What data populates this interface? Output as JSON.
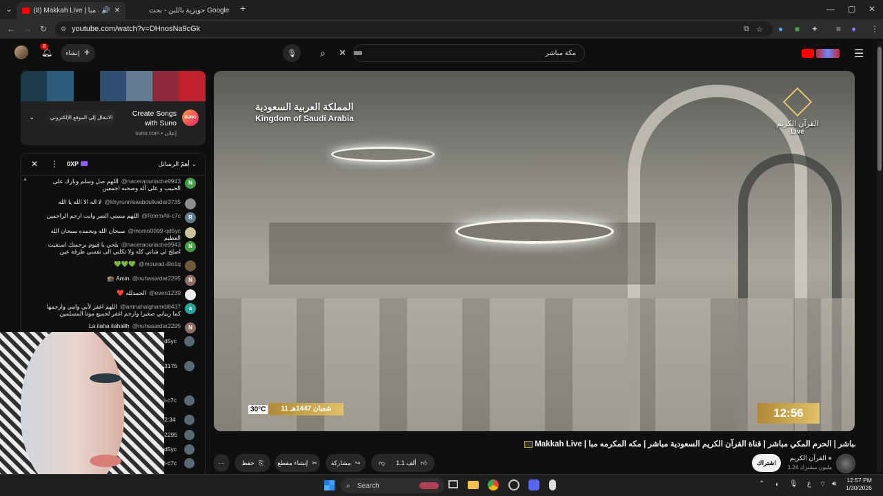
{
  "browser": {
    "tabs": [
      {
        "label": "(8) Makkah Live | مكة مبا",
        "active": true
      },
      {
        "label": "حويزية باللبن - بحث Google",
        "active": false
      }
    ],
    "url": "youtube.com/watch?v=DHnosNa9cGk"
  },
  "youtube": {
    "notification_count": "8",
    "create_label": "إنشاء",
    "search_value": "مكة مباشر"
  },
  "ad": {
    "title": "Create Songs with Suno",
    "domain": "suno.com • إعلان",
    "cta": "الانتقال إلى الموقع الإلكتروني",
    "logo_text": "SUNO"
  },
  "chat": {
    "header_label": "أهمّ الرسائل",
    "xp_label": "0XP",
    "messages": [
      {
        "author": "@naceraouriache9943",
        "text": "اللهم صل وسلم وبارك على الحبيب و على آله وصحبه اجمعين",
        "initial": "N",
        "color": "#43a047"
      },
      {
        "author": "@khyrunnisaabdulkadar3735",
        "text": "لا اله الا الله يا الله",
        "initial": "",
        "color": "#8d8d8d"
      },
      {
        "author": "@ReemAli-c7c",
        "text": "اللهم مسني الضر وانت ارحم الراحمين",
        "initial": "R",
        "color": "#607d8b"
      },
      {
        "author": "@momo0099-qd5yc",
        "text": "سبحان الله وبحمده سبحان الله العظيم",
        "initial": "",
        "color": "#c9c19a"
      },
      {
        "author": "@naceraouriache9943",
        "text": "يلحي يا قيوم برحمتك استغيث اصلح لي شاني كله ولا تكلني الى نفسي طرفة عين",
        "initial": "N",
        "color": "#43a047"
      },
      {
        "author": "@mourad-i9o1q",
        "text": "💚💚💚",
        "initial": "",
        "color": "#6d5a3a"
      },
      {
        "author": "@nuhasardar2295",
        "text": "Amin 🕋",
        "initial": "N",
        "color": "#8d6e63"
      },
      {
        "author": "@even1239",
        "text": "الحمدلله ❤️",
        "initial": "",
        "color": "#eeeeee"
      },
      {
        "author": "@amnahalghamdi8437",
        "text": "اللهم اغفر لأبي وامي وارحمها كما ربياني صغيرا وارحم اغفر لجميع موتا المسلمين",
        "initial": "a",
        "color": "#26a69a"
      },
      {
        "author": "@nuhasardar2295",
        "text": "La ilaha ilahallh",
        "initial": "N",
        "color": "#8d6e63"
      }
    ],
    "partial_tails": [
      "d5yc",
      "3175",
      "i-c7c",
      "2:34",
      "2295",
      "d5yc",
      "i-c7c"
    ]
  },
  "video": {
    "overlay_ar": "المملكة العربية السعودية",
    "overlay_en": "Kingdom of Saudi Arabia",
    "channel_logo_ar": "القرآن الكريم",
    "channel_logo_live": "Live",
    "temperature": "30°C",
    "hijri_date": "11 شعبان 1447هـ",
    "clock": "12:56",
    "title": "Makkah Live | مكة مباشر | الحرم المكي مباشر | قناة القرآن الكريم السعودية مباشر | مكه المكرمه مبا"
  },
  "actions": {
    "like_count": "1.1 ألف",
    "share_label": "مشاركة",
    "clip_label": "إنشاء مقطع",
    "save_label": "حفظ",
    "subscribe_label": "اشتراك",
    "channel_name": "القرآن الكريم",
    "subscribers": "1.24 مليون مشترك"
  },
  "taskbar": {
    "search_placeholder": "Search",
    "time": "12:57 PM",
    "date": "1/30/2026",
    "lang": "ع"
  }
}
